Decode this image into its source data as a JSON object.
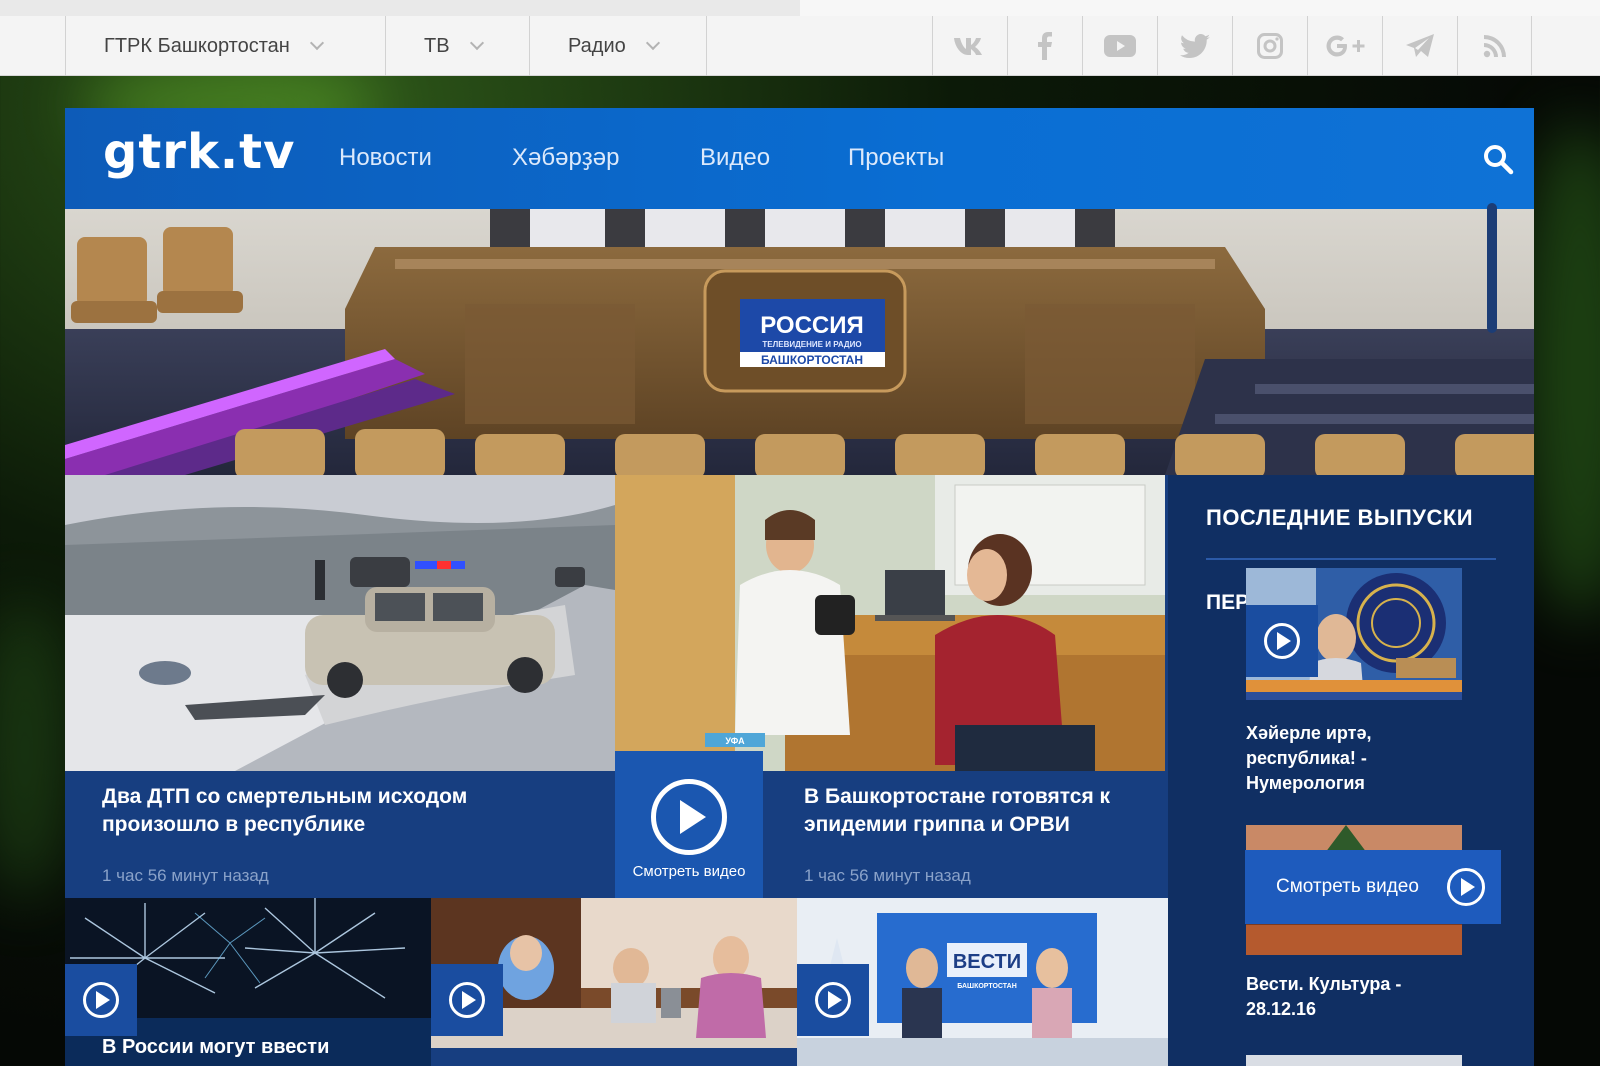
{
  "top_nav": {
    "items": [
      {
        "label": "ГТРК Башкортостан"
      },
      {
        "label": "ТВ"
      },
      {
        "label": "Радио"
      }
    ],
    "social_icons": [
      "vk-icon",
      "facebook-icon",
      "youtube-icon",
      "twitter-icon",
      "instagram-icon",
      "google-plus-icon",
      "telegram-icon",
      "rss-icon"
    ]
  },
  "site": {
    "logo": "gtrk.tv",
    "nav": [
      {
        "label": "Новости"
      },
      {
        "label": "Хәбәрҙәр"
      },
      {
        "label": "Видео"
      },
      {
        "label": "Проекты"
      }
    ]
  },
  "hero": {
    "screen_title": "РОССИЯ",
    "screen_sub": "ТЕЛЕВИДЕНИЕ И РАДИО",
    "screen_region": "БАШКОРТОСТАН"
  },
  "articles": [
    {
      "title": "Два ДТП со смертельным исходом произошло в республике",
      "time": "1 час 56 минут назад"
    },
    {
      "title": "В Башкортостане готовятся к эпидемии гриппа и ОРВИ",
      "time": "1 час 56 минут назад",
      "tag": "УФА"
    }
  ],
  "watch_video": {
    "label": "Смотреть видео"
  },
  "bottom_cards": [
    {
      "title": "В России могут ввести"
    },
    {
      "title": ""
    },
    {
      "title": "",
      "tv_logo": "ВЕСТИ",
      "tv_logo_sub": "БАШКОРТОСТАН"
    }
  ],
  "sidebar": {
    "title": "ПОСЛЕДНИЕ ВЫПУСКИ",
    "tab": "ПЕР",
    "items": [
      {
        "title": "Хәйерле иртә, республика! - Нумерология"
      },
      {
        "title": "Вести. Культура - 28.12.16"
      }
    ],
    "watch_button": "Смотреть видео"
  }
}
